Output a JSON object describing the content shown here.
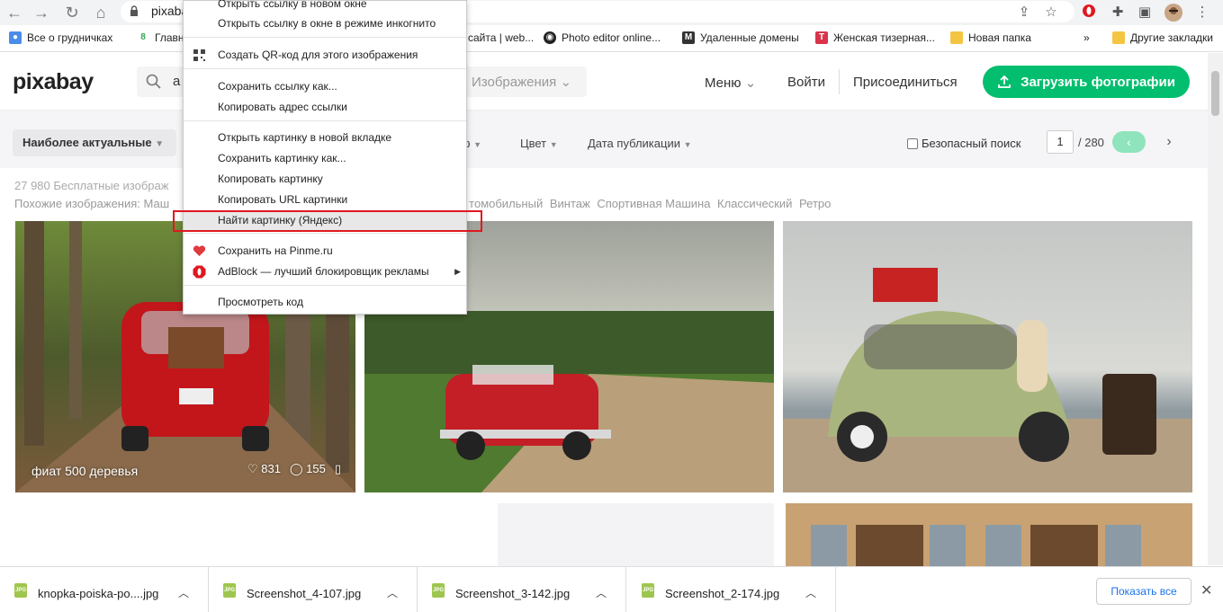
{
  "browser": {
    "url_text": "pixaba",
    "bookmarks": [
      {
        "label": "Все о грудничках",
        "color": "#4a8de8"
      },
      {
        "label": "Главн",
        "color": "#34a853"
      },
      {
        "label": "сайта | web...",
        "color": "#888888"
      },
      {
        "label": "Photo editor online...",
        "color": "#222222"
      },
      {
        "label": "Удаленные домены",
        "color": "#333333"
      },
      {
        "label": "Женская тизерная...",
        "color": "#d9344b"
      },
      {
        "label": "Новая папка",
        "color": "#f4c542"
      },
      {
        "label": "»",
        "color": ""
      },
      {
        "label": "Другие закладки",
        "color": "#f4c542"
      }
    ]
  },
  "header": {
    "logo": "pixabay",
    "search_value": "a",
    "search_type": "Изображения",
    "menu": "Меню",
    "login": "Войти",
    "join": "Присоединиться",
    "upload": "Загрузить фотографии"
  },
  "filters": {
    "sort": "Наиболее актуальные",
    "size_tail": "ер",
    "color": "Цвет",
    "date": "Дата публикации",
    "safe_search": "Безопасный поиск",
    "page": "1",
    "total": "/ 280"
  },
  "results": {
    "count": "27 980 Бесплатные изображ",
    "similar_label": "Похожие изображения: Маш",
    "similar_tags": [
      "томобильный",
      "Винтаж",
      "Спортивная Машина",
      "Классический",
      "Ретро"
    ]
  },
  "photos": [
    {
      "caption": "фиат 500  деревья",
      "likes": "831",
      "comments": "155"
    }
  ],
  "context_menu": {
    "items": [
      "Открыть ссылку в новом окне",
      "Открыть ссылку в окне в режиме инкогнито",
      "Создать QR-код для этого изображения",
      "Сохранить ссылку как...",
      "Копировать адрес ссылки",
      "Открыть картинку в новой вкладке",
      "Сохранить картинку как...",
      "Копировать картинку",
      "Копировать URL картинки",
      "Найти картинку (Яндекс)",
      "Сохранить на Pinme.ru",
      "AdBlock — лучший блокировщик рекламы",
      "Просмотреть код"
    ]
  },
  "downloads": {
    "files": [
      "knopka-poiska-po....jpg",
      "Screenshot_4-107.jpg",
      "Screenshot_3-142.jpg",
      "Screenshot_2-174.jpg"
    ],
    "show_all": "Показать все",
    "icon_text": "JPG"
  },
  "colors": {
    "accent": "#02be6e",
    "highlight": "#e0181f"
  }
}
